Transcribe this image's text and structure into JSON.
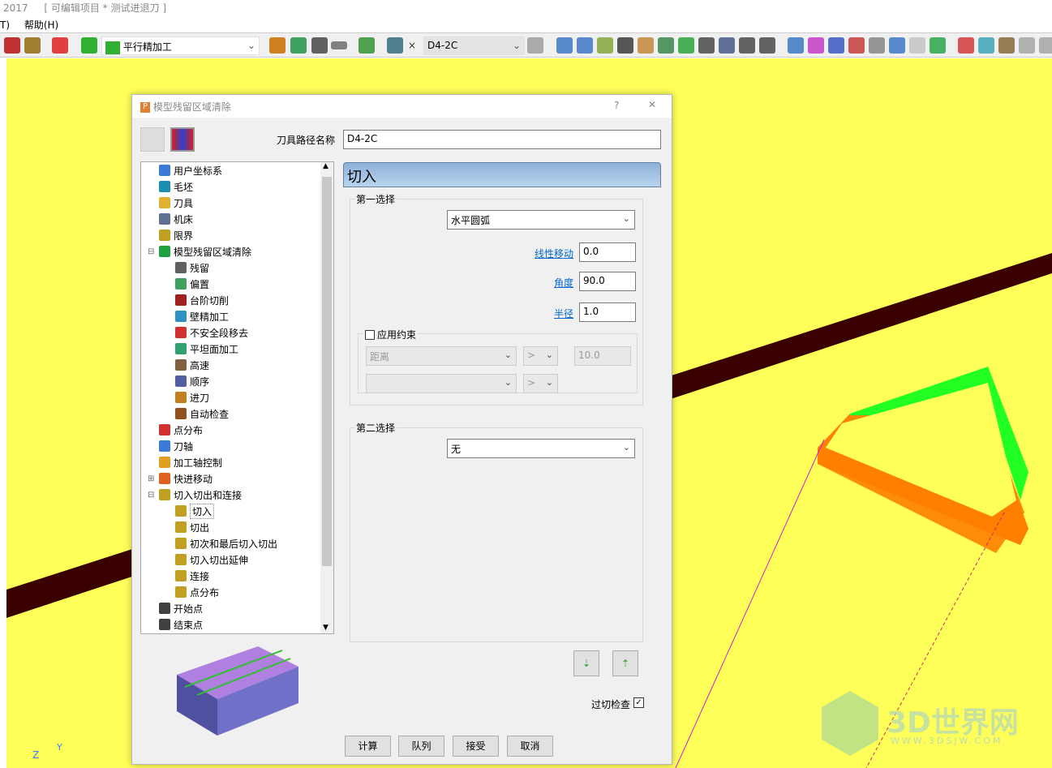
{
  "window": {
    "title_year": "2017",
    "title_project": "[ 可编辑项目 * 测试进退刀 ]"
  },
  "menu": [
    "T)",
    "帮助(H)"
  ],
  "toolbar": {
    "strategy_combo": "平行精加工",
    "toolpath_combo": "D4-2C",
    "close_x": "×"
  },
  "dialog": {
    "title": "模型残留区域清除",
    "help": "?",
    "close": "✕",
    "toolpath_name_label": "刀具路径名称",
    "toolpath_name_value": "D4-2C",
    "tree": [
      {
        "label": "用户坐标系",
        "level": 0,
        "icon_color": "#3a7bd5"
      },
      {
        "label": "毛坯",
        "level": 0,
        "icon_color": "#1b8fb0"
      },
      {
        "label": "刀具",
        "level": 0,
        "icon_color": "#e0b030"
      },
      {
        "label": "机床",
        "level": 0,
        "icon_color": "#607090"
      },
      {
        "label": "限界",
        "level": 0,
        "icon_color": "#c0a020"
      },
      {
        "label": "模型残留区域清除",
        "level": 0,
        "icon_color": "#20a040",
        "expander": "⊟"
      },
      {
        "label": "残留",
        "level": 1,
        "icon_color": "#606060"
      },
      {
        "label": "偏置",
        "level": 1,
        "icon_color": "#40a060"
      },
      {
        "label": "台阶切削",
        "level": 1,
        "icon_color": "#a02020"
      },
      {
        "label": "壁精加工",
        "level": 1,
        "icon_color": "#3090c0"
      },
      {
        "label": "不安全段移去",
        "level": 1,
        "icon_color": "#d03030"
      },
      {
        "label": "平坦面加工",
        "level": 1,
        "icon_color": "#30a070"
      },
      {
        "label": "高速",
        "level": 1,
        "icon_color": "#806040"
      },
      {
        "label": "顺序",
        "level": 1,
        "icon_color": "#5060a0"
      },
      {
        "label": "进刀",
        "level": 1,
        "icon_color": "#c08020"
      },
      {
        "label": "自动检查",
        "level": 1,
        "icon_color": "#905020"
      },
      {
        "label": "点分布",
        "level": 0,
        "icon_color": "#d03030"
      },
      {
        "label": "刀轴",
        "level": 0,
        "icon_color": "#3a7bd5"
      },
      {
        "label": "加工轴控制",
        "level": 0,
        "icon_color": "#e0a020"
      },
      {
        "label": "快进移动",
        "level": 0,
        "icon_color": "#e06020",
        "expander": "⊞"
      },
      {
        "label": "切入切出和连接",
        "level": 0,
        "icon_color": "#c0a020",
        "expander": "⊟"
      },
      {
        "label": "切入",
        "level": 1,
        "icon_color": "#c0a020",
        "selected": true
      },
      {
        "label": "切出",
        "level": 1,
        "icon_color": "#c0a020"
      },
      {
        "label": "初次和最后切入切出",
        "level": 1,
        "icon_color": "#c0a020"
      },
      {
        "label": "切入切出延伸",
        "level": 1,
        "icon_color": "#c0a020"
      },
      {
        "label": "连接",
        "level": 1,
        "icon_color": "#c0a020"
      },
      {
        "label": "点分布",
        "level": 1,
        "icon_color": "#c0a020"
      },
      {
        "label": "开始点",
        "level": 0,
        "icon_color": "#404040"
      },
      {
        "label": "结束点",
        "level": 0,
        "icon_color": "#404040"
      }
    ],
    "panel_title": "切入",
    "first_choice": {
      "label": "第一选择",
      "type": "水平圆弧",
      "linear_label": "线性移动",
      "linear": "0.0",
      "angle_label": "角度",
      "angle": "90.0",
      "radius_label": "半径",
      "radius": "1.0",
      "constraint_label": "应用约束",
      "constraint_checked": false,
      "constraint_type": "距离",
      "constraint_op": ">",
      "constraint_value": "10.0",
      "constraint_op2": ">"
    },
    "second_choice": {
      "label": "第二选择",
      "type": "无"
    },
    "gouge_check_label": "过切检查",
    "gouge_check_checked": true,
    "buttons": {
      "calculate": "计算",
      "queue": "队列",
      "accept": "接受",
      "cancel": "取消"
    }
  },
  "watermark": {
    "text": "3D世界网",
    "url": "WWW.3DSJW.COM"
  },
  "axis": {
    "z": "Z",
    "y": "Y"
  }
}
